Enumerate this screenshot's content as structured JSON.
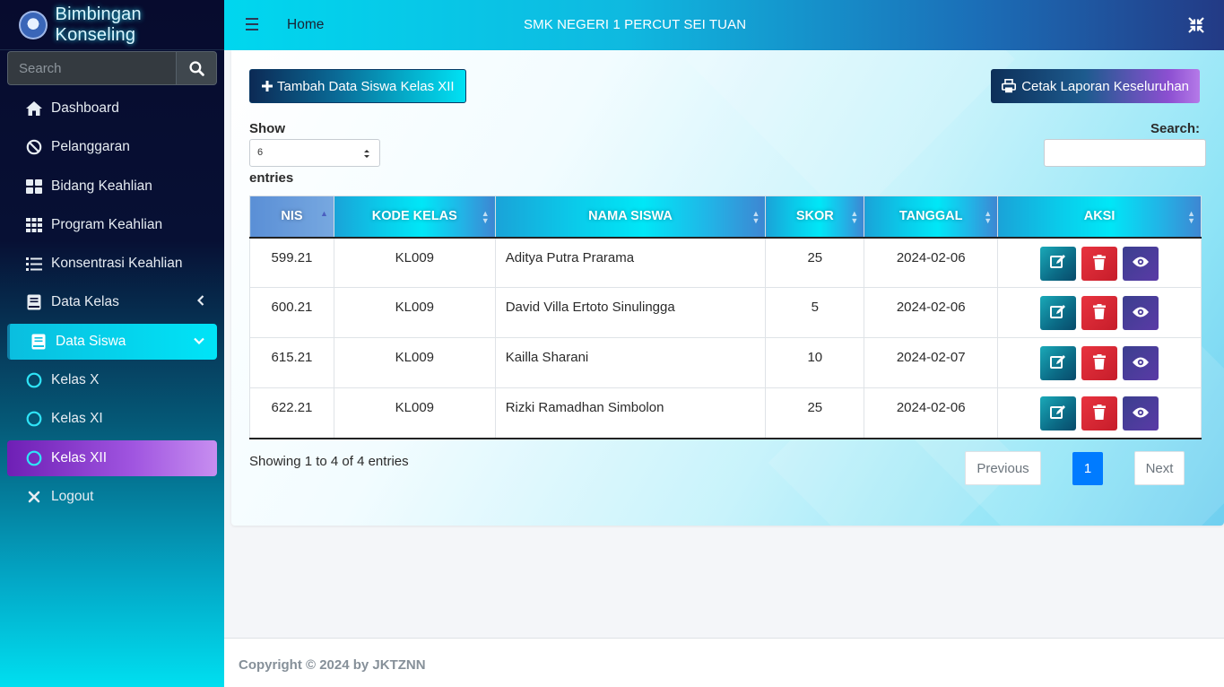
{
  "brand": {
    "title": "Bimbingan Konseling"
  },
  "sidebar": {
    "search_placeholder": "Search",
    "items": [
      {
        "label": "Dashboard",
        "icon": "home-icon"
      },
      {
        "label": "Pelanggaran",
        "icon": "ban-icon"
      },
      {
        "label": "Bidang Keahlian",
        "icon": "grid-icon"
      },
      {
        "label": "Program Keahlian",
        "icon": "grid-3x3-icon"
      },
      {
        "label": "Konsentrasi Keahlian",
        "icon": "list-icon"
      },
      {
        "label": "Data Kelas",
        "icon": "book-icon"
      },
      {
        "label": "Data Siswa",
        "icon": "book-icon"
      },
      {
        "label": "Kelas X",
        "icon": "circle-icon"
      },
      {
        "label": "Kelas XI",
        "icon": "circle-icon"
      },
      {
        "label": "Kelas XII",
        "icon": "circle-icon"
      },
      {
        "label": "Logout",
        "icon": "times-icon"
      }
    ]
  },
  "header": {
    "home": "Home",
    "school": "SMK NEGERI 1 PERCUT SEI TUAN"
  },
  "toolbar": {
    "add_label": "Tambah Data Siswa Kelas XII",
    "print_label": "Cetak Laporan Keseluruhan"
  },
  "table_controls": {
    "show_label": "Show",
    "show_value": "6",
    "entries_label": "entries",
    "search_label": "Search:",
    "search_value": ""
  },
  "table": {
    "columns": [
      "NIS",
      "KODE KELAS",
      "NAMA SISWA",
      "SKOR",
      "TANGGAL",
      "AKSI"
    ],
    "rows": [
      {
        "nis": "599.21",
        "kode": "KL009",
        "nama": "Aditya Putra Prarama",
        "skor": "25",
        "tanggal": "2024-02-06"
      },
      {
        "nis": "600.21",
        "kode": "KL009",
        "nama": "David Villa Ertoto Sinulingga",
        "skor": "5",
        "tanggal": "2024-02-06"
      },
      {
        "nis": "615.21",
        "kode": "KL009",
        "nama": "Kailla Sharani",
        "skor": "10",
        "tanggal": "2024-02-07"
      },
      {
        "nis": "622.21",
        "kode": "KL009",
        "nama": "Rizki Ramadhan Simbolon",
        "skor": "25",
        "tanggal": "2024-02-06"
      }
    ]
  },
  "pagination": {
    "info": "Showing 1 to 4 of 4 entries",
    "previous": "Previous",
    "current": "1",
    "next": "Next"
  },
  "footer": {
    "text": "Copyright © 2024 by JKTZNN"
  }
}
